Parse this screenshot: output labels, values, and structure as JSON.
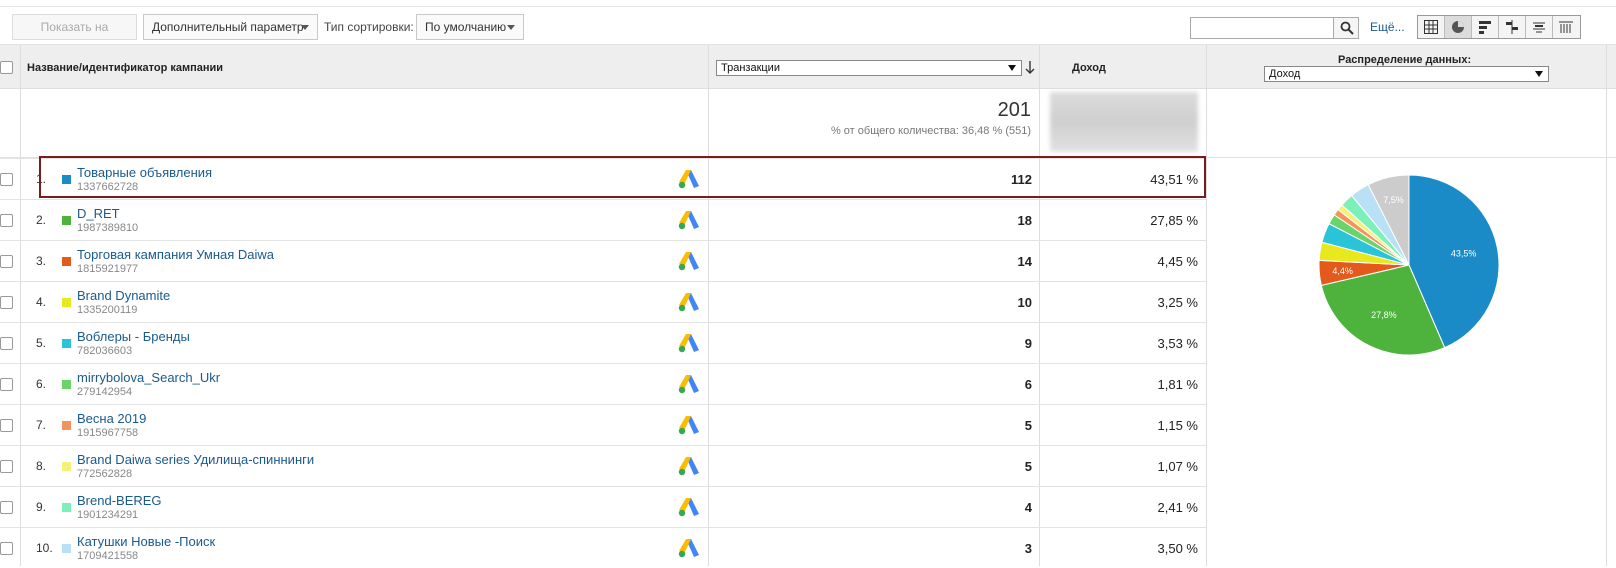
{
  "toolbar": {
    "show_on_chart": "Показать на диаграмме",
    "secondary_dim": "Дополнительный параметр",
    "sort_type_label": "Тип сортировки:",
    "sort_type_value": "По умолчанию",
    "search_value": "",
    "more_label": "Ещё...",
    "view_icons": [
      "table-view-icon",
      "pie-view-icon",
      "bar-view-icon",
      "comparison-view-icon",
      "term-cloud-icon",
      "pivot-view-icon"
    ]
  },
  "table": {
    "col_campaign": "Название/идентификатор кампании",
    "col_metric_select": "Транзакции",
    "col_revenue": "Доход",
    "col_distribution": "Распределение данных:",
    "distribution_select": "Доход",
    "summary_total": "201",
    "summary_sub": "% от общего количества: 36,48 % (551)",
    "rows": [
      {
        "num": "1.",
        "name": "Товарные объявления",
        "id": "1337662728",
        "color": "#1a8bc6",
        "tx": "112",
        "rev": "43,51 %"
      },
      {
        "num": "2.",
        "name": "D_RET",
        "id": "1987389810",
        "color": "#4db33d",
        "tx": "18",
        "rev": "27,85 %"
      },
      {
        "num": "3.",
        "name": "Торговая кампания Умная Daiwa",
        "id": "1815921977",
        "color": "#e45a1c",
        "tx": "14",
        "rev": "4,45 %"
      },
      {
        "num": "4.",
        "name": "Brand Dynamite",
        "id": "1335200119",
        "color": "#e8e81f",
        "tx": "10",
        "rev": "3,25 %"
      },
      {
        "num": "5.",
        "name": "Воблеры - Бренды",
        "id": "782036603",
        "color": "#29c4d8",
        "tx": "9",
        "rev": "3,53 %"
      },
      {
        "num": "6.",
        "name": "mirrybolova_Search_Ukr",
        "id": "279142954",
        "color": "#6ad46a",
        "tx": "6",
        "rev": "1,81 %"
      },
      {
        "num": "7.",
        "name": "Весна 2019",
        "id": "1915967758",
        "color": "#f2945c",
        "tx": "5",
        "rev": "1,15 %"
      },
      {
        "num": "8.",
        "name": "Brand Daiwa series Удилища-спиннинги",
        "id": "772562828",
        "color": "#f5f07a",
        "tx": "5",
        "rev": "1,07 %"
      },
      {
        "num": "9.",
        "name": "Brend-BEREG",
        "id": "1901234291",
        "color": "#7df0b9",
        "tx": "4",
        "rev": "2,41 %"
      },
      {
        "num": "10.",
        "name": "Катушки Новые -Поиск",
        "id": "1709421558",
        "color": "#b9e0f5",
        "tx": "3",
        "rev": "3,50 %"
      }
    ]
  },
  "chart_data": {
    "type": "pie",
    "categories": [
      "Товарные объявления",
      "D_RET",
      "Торговая кампания Умная Daiwa",
      "Brand Dynamite",
      "Воблеры - Бренды",
      "mirrybolova_Search_Ukr",
      "Весна 2019",
      "Brand Daiwa series Удилища-спиннинги",
      "Brend-BEREG",
      "Катушки Новые -Поиск",
      ""
    ],
    "values": [
      43.51,
      27.85,
      4.45,
      3.25,
      3.53,
      1.81,
      1.15,
      1.07,
      2.41,
      3.5,
      7.47
    ],
    "colors": [
      "#1a8bc6",
      "#4db33d",
      "#e45a1c",
      "#e8e81f",
      "#29c4d8",
      "#6ad46a",
      "#f2945c",
      "#f5f07a",
      "#7df0b9",
      "#b9e0f5",
      "#cccccc"
    ],
    "labels": [
      "43,5%",
      "27,8%",
      "4,4%",
      "",
      "",
      "",
      "",
      "",
      "",
      "",
      "7,5%"
    ]
  }
}
